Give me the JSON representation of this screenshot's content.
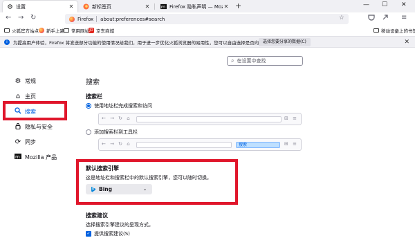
{
  "tabs": [
    {
      "label": "设置",
      "icon": "gear-icon",
      "active": true
    },
    {
      "label": "新标签页",
      "icon": "firefox-icon",
      "active": false
    },
    {
      "label": "Firefox 隐私声明 — Mozilla",
      "icon": "mozilla-icon",
      "active": false
    }
  ],
  "window_controls": {
    "minimize": "—",
    "maximize": "☐",
    "close": "✕"
  },
  "navbar": {
    "brand": "Firefox",
    "url": "about:preferences#search"
  },
  "bookmarks": {
    "items": [
      "火狐官方站点",
      "新手上路",
      "常用网址",
      "京东商城"
    ],
    "other": "移动设备上的书签"
  },
  "notice": {
    "text": "为提高用户体验，Firefox 将发送部分功能的使用情况给我们，用于进一步优化火狐浏览器的易用性，您可以自由选择是否向我们分享数据。",
    "button": "选择您要分享的数据(C)"
  },
  "search": {
    "placeholder": "在设置中查找"
  },
  "sidebar": {
    "items": [
      {
        "label": "常规",
        "icon": "gear-icon"
      },
      {
        "label": "主页",
        "icon": "home-icon"
      },
      {
        "label": "搜索",
        "icon": "search-icon",
        "selected": true
      },
      {
        "label": "隐私与安全",
        "icon": "lock-icon"
      },
      {
        "label": "同步",
        "icon": "sync-icon"
      },
      {
        "label": "Mozilla 产品",
        "icon": "mozilla-icon"
      }
    ]
  },
  "main": {
    "title": "搜索",
    "searchbar_heading": "搜索栏",
    "option_urlbar": "使用地址栏完成搜索和访问",
    "option_toolbar": "添加搜索栏到工具栏",
    "preview_search": "搜索",
    "default_engine_heading": "默认搜索引擎",
    "default_engine_desc": "这是地址栏和搜索栏中的默认搜索引擎，您可以随时切换。",
    "engine_selected": "Bing",
    "suggestions_heading": "搜索建议",
    "suggestions_desc": "选择搜索引擎建议的呈现方式。",
    "suggestions_checkbox": "提供搜索建议(S)"
  },
  "colors": {
    "accent": "#0061e0",
    "highlight": "#e0162b"
  }
}
